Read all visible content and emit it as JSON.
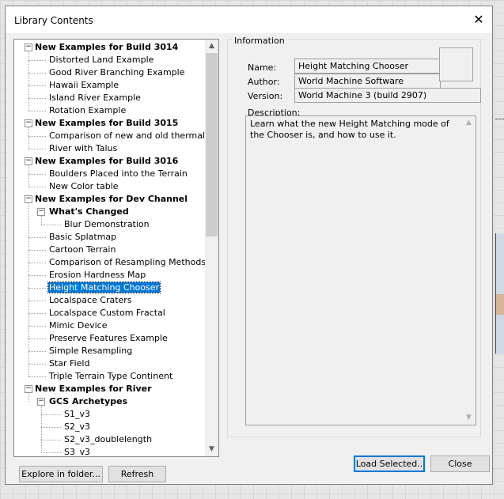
{
  "window": {
    "title": "Library Contents"
  },
  "tree": {
    "items": [
      {
        "label": "New Examples for Build 3014",
        "level": 0,
        "bold": true,
        "expanded": true
      },
      {
        "label": "Distorted Land Example",
        "level": 1
      },
      {
        "label": "Good River Branching Example",
        "level": 1
      },
      {
        "label": "Hawaii Example",
        "level": 1
      },
      {
        "label": "Island River Example",
        "level": 1
      },
      {
        "label": "Rotation Example",
        "level": 1
      },
      {
        "label": "New Examples for Build 3015",
        "level": 0,
        "bold": true,
        "expanded": true
      },
      {
        "label": "Comparison of new and old thermal erosi",
        "level": 1
      },
      {
        "label": "River with Talus",
        "level": 1
      },
      {
        "label": "New Examples for Build 3016",
        "level": 0,
        "bold": true,
        "expanded": true
      },
      {
        "label": "Boulders Placed into the Terrain",
        "level": 1
      },
      {
        "label": "New Color table",
        "level": 1
      },
      {
        "label": "New Examples for Dev Channel",
        "level": 0,
        "bold": true,
        "expanded": true
      },
      {
        "label": "What's Changed",
        "level": 1,
        "bold": true,
        "expanded": true
      },
      {
        "label": "Blur Demonstration",
        "level": 2
      },
      {
        "label": "Basic Splatmap",
        "level": 1
      },
      {
        "label": "Cartoon Terrain",
        "level": 1
      },
      {
        "label": "Comparison of Resampling Methods",
        "level": 1
      },
      {
        "label": "Erosion Hardness Map",
        "level": 1
      },
      {
        "label": "Height Matching Chooser",
        "level": 1,
        "selected": true
      },
      {
        "label": "Localspace Craters",
        "level": 1
      },
      {
        "label": "Localspace Custom Fractal",
        "level": 1
      },
      {
        "label": "Mimic Device",
        "level": 1
      },
      {
        "label": "Preserve Features Example",
        "level": 1
      },
      {
        "label": "Simple Resampling",
        "level": 1
      },
      {
        "label": "Star Field",
        "level": 1
      },
      {
        "label": "Triple Terrain Type Continent",
        "level": 1
      },
      {
        "label": "New Examples for River",
        "level": 0,
        "bold": true,
        "expanded": true
      },
      {
        "label": "GCS Archetypes",
        "level": 1,
        "bold": true,
        "expanded": true
      },
      {
        "label": "S1_v3",
        "level": 2
      },
      {
        "label": "S2_v3",
        "level": 2
      },
      {
        "label": "S2_v3_doublelength",
        "level": 2
      },
      {
        "label": "S3_v3",
        "level": 2
      }
    ]
  },
  "info": {
    "group_label": "Information",
    "name_label": "Name:",
    "name_value": "Height Matching Chooser",
    "author_label": "Author:",
    "author_value": "World Machine Software",
    "version_label": "Version:",
    "version_value": "World Machine 3 (build 2907)",
    "description_label": "Description:",
    "description_text": "Learn what the new Height Matching mode of the Chooser is, and how to use it."
  },
  "buttons": {
    "explore": "Explore in folder...",
    "refresh": "Refresh",
    "load": "Load Selected..",
    "close": "Close"
  },
  "icons": {
    "close": "close-icon",
    "expand_toggle": "minus-box-icon",
    "scroll_up": "chevron-up-icon",
    "scroll_down": "chevron-down-icon"
  }
}
